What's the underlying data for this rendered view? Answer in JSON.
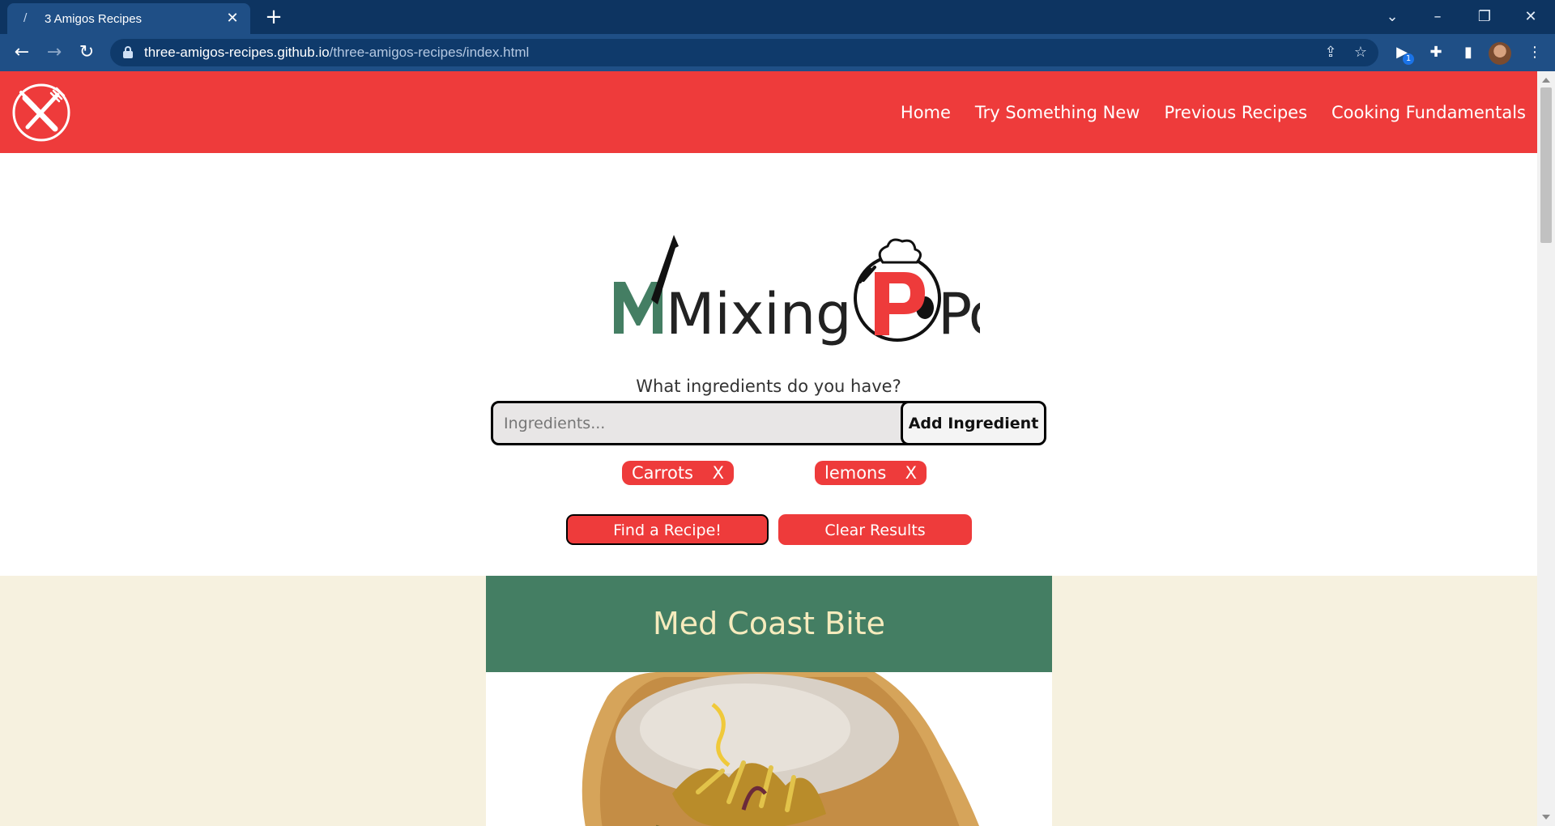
{
  "browser": {
    "tab_title": "3 Amigos Recipes",
    "url_host": "three-amigos-recipes.github.io",
    "url_path": "/three-amigos-recipes/index.html",
    "extension_badge": "1"
  },
  "site": {
    "nav": [
      "Home",
      "Try Something New",
      "Previous Recipes",
      "Cooking Fundamentals"
    ],
    "logo_text_1": "Mixing",
    "logo_text_2": "Pot",
    "question": "What ingredients do you have?",
    "search": {
      "placeholder": "Ingredients...",
      "value": ""
    },
    "add_button": "Add Ingredient",
    "chip_remove": "X",
    "ingredients": [
      "Carrots",
      "lemons"
    ],
    "find_button": "Find a Recipe!",
    "clear_button": "Clear Results",
    "result_title": "Med Coast Bite"
  },
  "colors": {
    "header_red": "#ee3b3b",
    "card_green": "#447e63",
    "card_title": "#f6ebbd",
    "results_bg": "#f6f1df"
  }
}
